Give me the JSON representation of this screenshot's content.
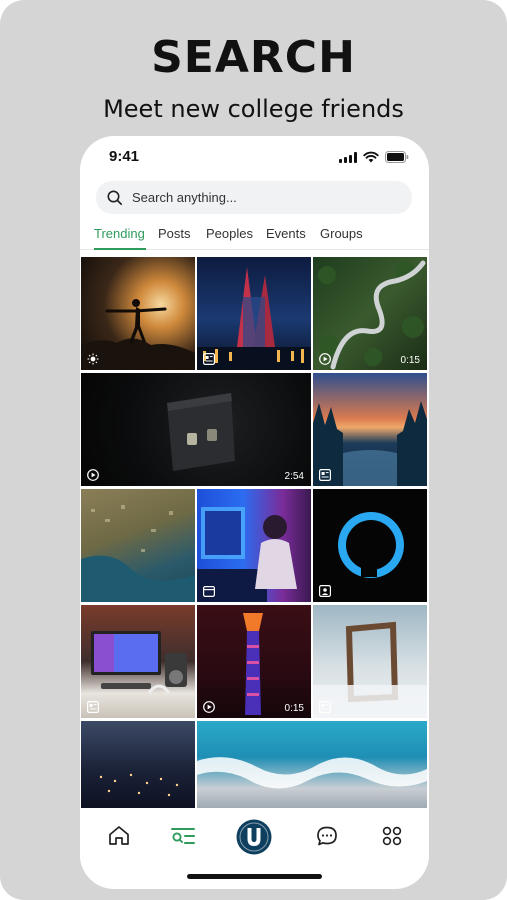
{
  "promo": {
    "headline": "SEARCH",
    "subhead": "Meet new college friends"
  },
  "status_bar": {
    "time": "9:41"
  },
  "search": {
    "placeholder": "Search anything..."
  },
  "tabs": [
    {
      "label": "Trending",
      "active": true
    },
    {
      "label": "Posts",
      "active": false
    },
    {
      "label": "Peoples",
      "active": false
    },
    {
      "label": "Events",
      "active": false
    },
    {
      "label": "Groups",
      "active": false
    }
  ],
  "feed": {
    "tiles": [
      {
        "subject": "yoga silhouette at sunset",
        "badge": "sun-icon",
        "duration": ""
      },
      {
        "subject": "city skyscrapers at night",
        "badge": "article-icon",
        "duration": ""
      },
      {
        "subject": "winding road through forest",
        "badge": "video-icon",
        "duration": "0:15"
      },
      {
        "subject": "dark card product shot",
        "badge": "video-icon",
        "duration": "2:54"
      },
      {
        "subject": "forest lake at sunset",
        "badge": "article-icon",
        "duration": ""
      },
      {
        "subject": "aerial coastline",
        "badge": "",
        "duration": ""
      },
      {
        "subject": "person at computer in neon light",
        "badge": "calendar-icon",
        "duration": ""
      },
      {
        "subject": "profile silhouette in blue circle",
        "badge": "profile-icon",
        "duration": ""
      },
      {
        "subject": "desk setup with monitor",
        "badge": "article-icon",
        "duration": ""
      },
      {
        "subject": "illuminated tower at night",
        "badge": "video-icon",
        "duration": "0:15"
      },
      {
        "subject": "wooden frame in fog",
        "badge": "article-icon",
        "duration": ""
      },
      {
        "subject": "city lights at dusk",
        "badge": "",
        "duration": ""
      },
      {
        "subject": "ocean waves aerial",
        "badge": "",
        "duration": ""
      }
    ]
  },
  "bottom_nav": {
    "items": [
      {
        "icon": "home-icon",
        "active": false
      },
      {
        "icon": "search-list-icon",
        "active": true
      },
      {
        "icon": "app-logo-icon",
        "active": false
      },
      {
        "icon": "chat-icon",
        "active": false
      },
      {
        "icon": "grid-apps-icon",
        "active": false
      }
    ]
  },
  "colors": {
    "accent": "#2f9b5d",
    "logo": "#0e3f5e",
    "background": "#d5d5d5"
  }
}
